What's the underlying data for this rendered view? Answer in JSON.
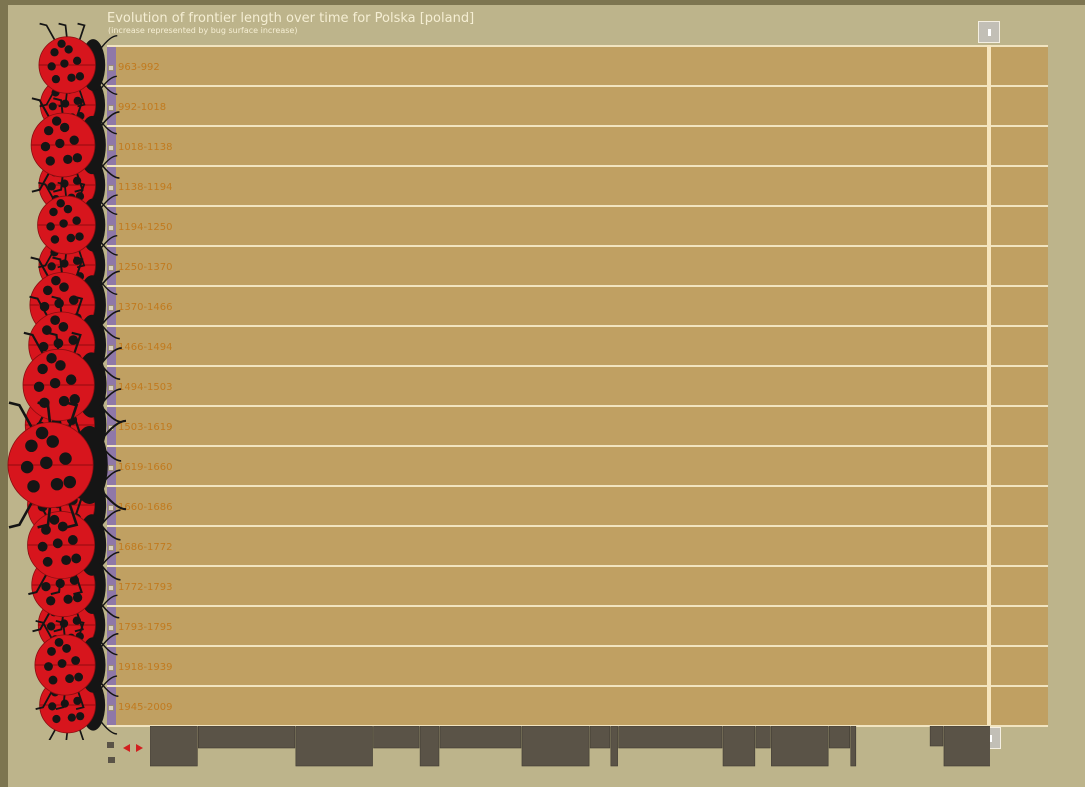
{
  "chart_data": {
    "type": "bar",
    "title": "Evolution of frontier length over time for Polska [poland]",
    "subtitle": "(increase represented by bug surface increase)",
    "categories": [
      "963-992",
      "992-1018",
      "1018-1138",
      "1138-1194",
      "1194-1250",
      "1250-1370",
      "1370-1466",
      "1466-1494",
      "1494-1503",
      "1503-1619",
      "1619-1660",
      "1660-1686",
      "1686-1772",
      "1772-1793",
      "1793-1795",
      "1918-1939",
      "1945-2009"
    ],
    "values": [
      0.44,
      0.42,
      0.56,
      0.44,
      0.46,
      0.44,
      0.58,
      0.6,
      0.7,
      0.66,
      1.0,
      0.62,
      0.62,
      0.55,
      0.45,
      0.5,
      0.43
    ]
  },
  "colors": {
    "frame": "#7d7550",
    "panel": "#bdb48b",
    "row_fill": "#c0a062",
    "row_line": "#f1e4c0",
    "label": "#c17a1e",
    "accent_bar": "#8f78a8",
    "bug_red": "#d7151d",
    "bug_black": "#151515",
    "timeline": "#5a5347",
    "arrow": "#d21f1f"
  },
  "icons": {
    "bug": "ladybug-icon",
    "handle": "scroll-handle-icon",
    "prev": "arrow-left-icon",
    "next": "arrow-right-icon"
  },
  "timeline_segments": [
    [
      0.0,
      0.56,
      0.1,
      1.0
    ],
    [
      0.56,
      1.69,
      0.1,
      0.55
    ],
    [
      1.69,
      2.59,
      0.1,
      1.0
    ],
    [
      2.59,
      3.13,
      0.1,
      0.55
    ],
    [
      3.13,
      3.36,
      0.1,
      1.0
    ],
    [
      3.36,
      4.31,
      0.1,
      0.55
    ],
    [
      4.31,
      5.1,
      0.1,
      1.0
    ],
    [
      5.1,
      5.34,
      0.1,
      0.55
    ],
    [
      5.34,
      5.43,
      0.1,
      1.0
    ],
    [
      5.43,
      6.64,
      0.1,
      0.55
    ],
    [
      6.64,
      7.02,
      0.1,
      1.0
    ],
    [
      7.02,
      7.2,
      0.1,
      0.55
    ],
    [
      7.2,
      7.87,
      0.1,
      1.0
    ],
    [
      7.87,
      8.12,
      0.1,
      0.55
    ],
    [
      8.12,
      8.19,
      0.1,
      1.0
    ],
    [
      9.04,
      9.2,
      0.1,
      0.5
    ],
    [
      9.2,
      9.75,
      0.1,
      1.0
    ]
  ]
}
